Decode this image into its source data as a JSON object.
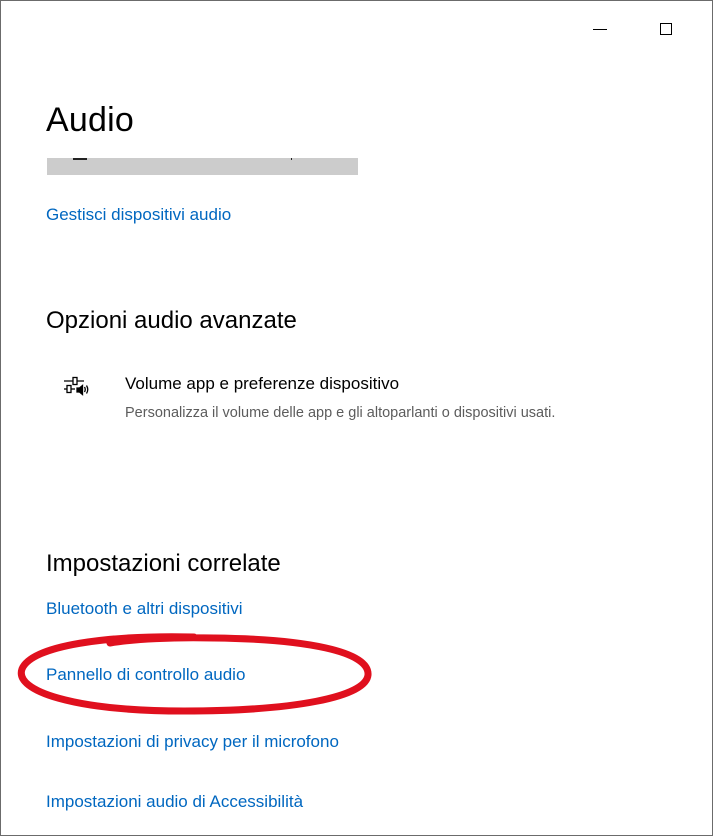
{
  "window": {
    "minimize_icon": "minimize-icon",
    "maximize_icon": "maximize-icon"
  },
  "page": {
    "title": "Audio"
  },
  "links": {
    "manage_devices": "Gestisci dispositivi audio"
  },
  "advanced": {
    "heading": "Opzioni audio avanzate",
    "option": {
      "icon": "volume-mixer-icon",
      "title": "Volume app e preferenze dispositivo",
      "description": "Personalizza il volume delle app e gli altoparlanti o dispositivi usati."
    }
  },
  "related": {
    "heading": "Impostazioni correlate",
    "links": [
      "Bluetooth e altri dispositivi",
      "Pannello di controllo audio",
      "Impostazioni di privacy per il microfono",
      "Impostazioni audio di Accessibilità"
    ]
  },
  "colors": {
    "link": "#0067c0",
    "highlight_annotation": "#e0101e",
    "secondary_text": "#5c5c5c"
  }
}
